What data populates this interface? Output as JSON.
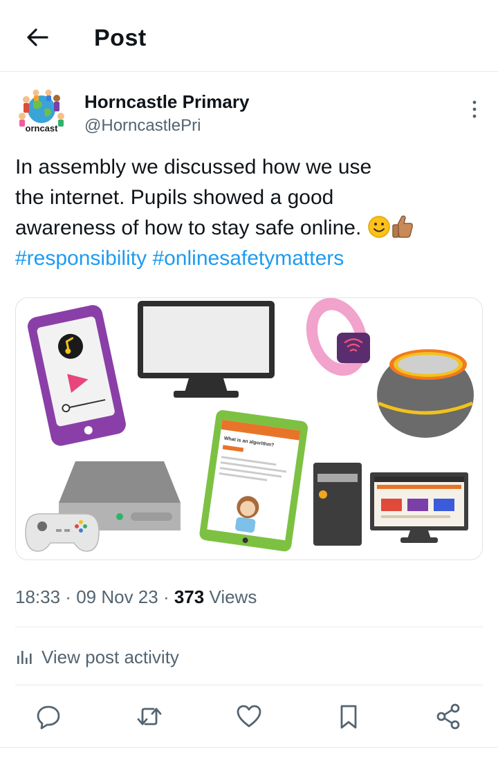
{
  "header": {
    "title": "Post",
    "back_icon": "arrow-left-icon"
  },
  "author": {
    "display_name": "Horncastle Primary",
    "handle": "@HorncastlePri",
    "avatar_text": "orncast",
    "more_icon": "more-vertical-icon"
  },
  "post": {
    "lines": [
      "In assembly we discussed how we use",
      "the internet. Pupils showed a good",
      "awareness of how to stay safe online."
    ],
    "emojis": [
      "smiling-face-emoji",
      "thumbs-up-emoji"
    ],
    "hashtags": [
      "#responsibility",
      "#onlinesafetymatters"
    ],
    "media_icons": [
      "music-player-phone-icon",
      "computer-monitor-icon",
      "smart-watch-icon",
      "smart-speaker-icon",
      "tablet-icon",
      "game-console-icon",
      "desktop-computer-icon"
    ],
    "tablet_title": "What is an algorithm?"
  },
  "meta": {
    "time": "18:33",
    "separator": " · ",
    "date": "09 Nov 23",
    "views_count": "373",
    "views_label": " Views"
  },
  "activity": {
    "label": "View post activity",
    "icon": "bar-chart-icon"
  },
  "actions": [
    "reply-icon",
    "repost-icon",
    "like-icon",
    "bookmark-icon",
    "share-icon"
  ],
  "colors": {
    "link": "#1d9bf0",
    "muted": "#536471",
    "text": "#0f1419",
    "divider": "#e6e9eb"
  }
}
